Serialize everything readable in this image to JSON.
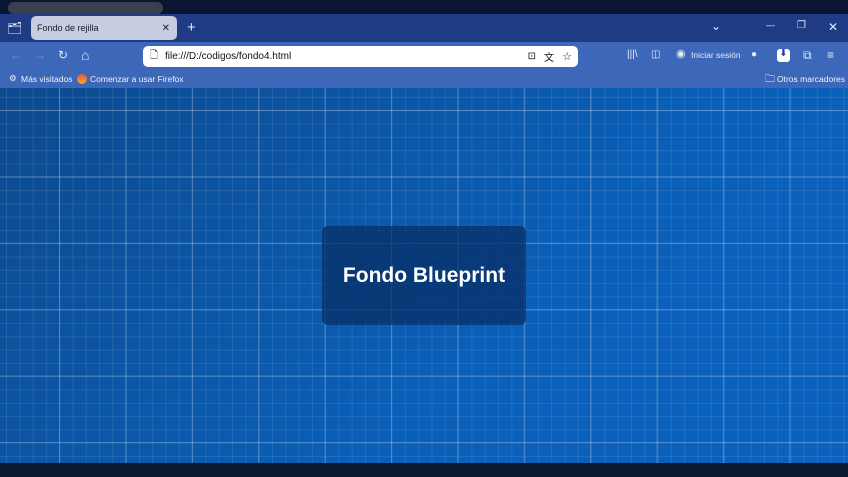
{
  "tab": {
    "title": "Fondo de rejilla",
    "close": "✕",
    "new": "+"
  },
  "window": {
    "list": "⌄",
    "minimize": "—",
    "restore": "❐",
    "close": "✕"
  },
  "nav": {
    "back": "←",
    "forward": "→",
    "reload": "↻",
    "home": "⌂",
    "url": "file:///D:/codigos/fondo4.html",
    "signin": "Iniciar sesión"
  },
  "bookmarks": {
    "most_visited": "Más visitados",
    "getting_started": "Comenzar a usar Firefox",
    "other": "Otros marcadores"
  },
  "page": {
    "title": "Fondo Blueprint"
  }
}
